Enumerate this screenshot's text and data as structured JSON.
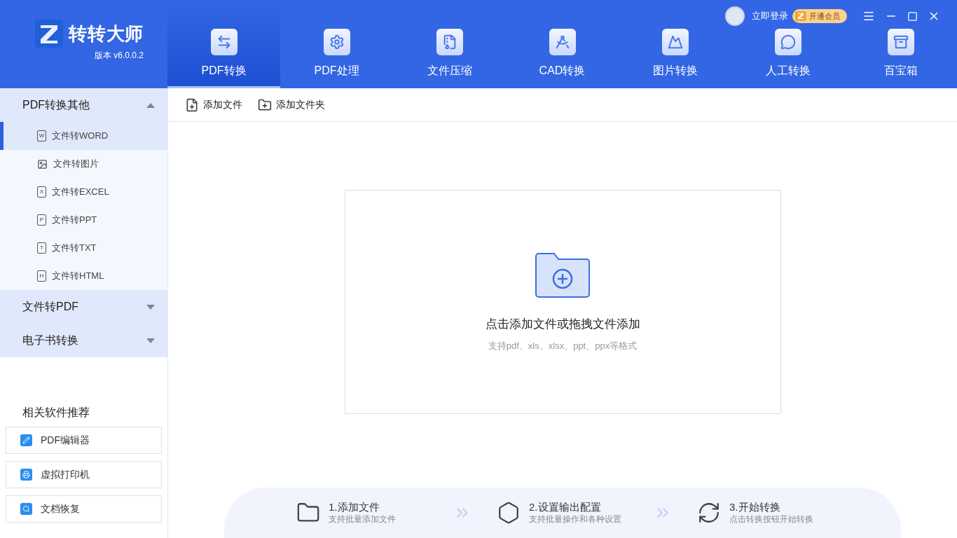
{
  "app": {
    "name": "转转大师",
    "version": "版本 v6.0.0.2"
  },
  "account": {
    "login": "立即登录",
    "vip": "开通会员"
  },
  "tabs": [
    {
      "label": "PDF转换",
      "selected": true,
      "kind": "convert"
    },
    {
      "label": "PDF处理",
      "selected": false,
      "kind": "process"
    },
    {
      "label": "文件压缩",
      "selected": false,
      "kind": "zip"
    },
    {
      "label": "CAD转换",
      "selected": false,
      "kind": "cad"
    },
    {
      "label": "图片转换",
      "selected": false,
      "kind": "image"
    },
    {
      "label": "人工转换",
      "selected": false,
      "kind": "chat"
    },
    {
      "label": "百宝箱",
      "selected": false,
      "kind": "box"
    }
  ],
  "sidebar": {
    "groups": [
      {
        "label": "PDF转换其他",
        "expanded": true,
        "children": [
          {
            "label": "文件转WORD",
            "badge": "W",
            "kind": "doc",
            "selected": true
          },
          {
            "label": "文件转图片",
            "kind": "image",
            "selected": false
          },
          {
            "label": "文件转EXCEL",
            "badge": "X",
            "kind": "doc",
            "selected": false
          },
          {
            "label": "文件转PPT",
            "badge": "P",
            "kind": "doc",
            "selected": false
          },
          {
            "label": "文件转TXT",
            "badge": "T",
            "kind": "doc",
            "selected": false
          },
          {
            "label": "文件转HTML",
            "badge": "H",
            "kind": "doc",
            "selected": false
          }
        ]
      },
      {
        "label": "文件转PDF",
        "expanded": false
      },
      {
        "label": "电子书转换",
        "expanded": false
      }
    ]
  },
  "recommend": {
    "title": "相关软件推荐",
    "items": [
      {
        "label": "PDF编辑器",
        "kind": "editor"
      },
      {
        "label": "虚拟打印机",
        "kind": "printer"
      },
      {
        "label": "文档恢复",
        "kind": "recover"
      }
    ]
  },
  "toolbar": [
    {
      "label": "添加文件",
      "kind": "file"
    },
    {
      "label": "添加文件夹",
      "kind": "folder"
    }
  ],
  "dropzone": {
    "title": "点击添加文件或拖拽文件添加",
    "hint": "支持pdf、xls、xlsx、ppt、ppx等格式"
  },
  "steps": [
    {
      "title": "1.添加文件",
      "subtitle": "支持批量添加文件",
      "kind": "folder"
    },
    {
      "title": "2.设置输出配置",
      "subtitle": "支持批量操作和各种设置",
      "kind": "settings"
    },
    {
      "title": "3.开始转换",
      "subtitle": "点击转换按钮开始转换",
      "kind": "convert"
    }
  ]
}
